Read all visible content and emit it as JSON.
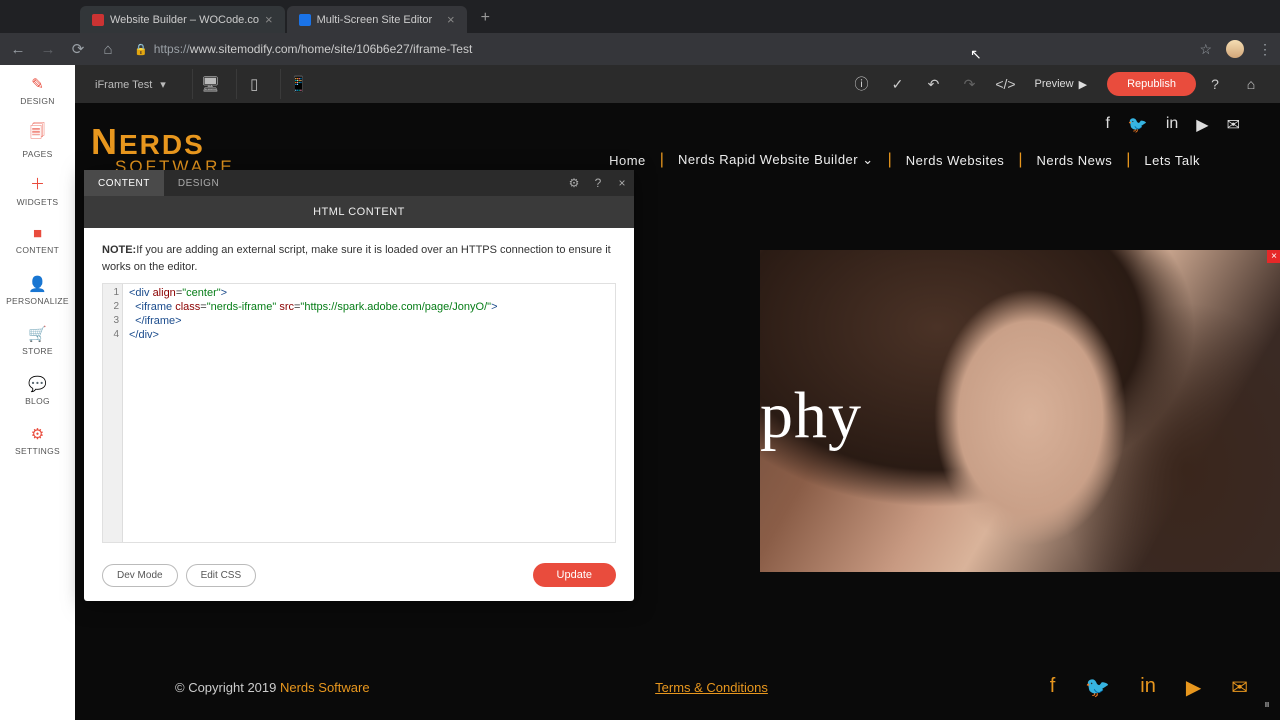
{
  "browser": {
    "tabs": [
      {
        "label": "Website Builder – WOCode.co"
      },
      {
        "label": "Multi-Screen Site Editor"
      }
    ],
    "url_proto": "https://",
    "url_rest": "www.sitemodify.com/home/site/106b6e27/iframe-Test"
  },
  "topbar": {
    "site_name": "iFrame Test",
    "preview": "Preview",
    "republish": "Republish"
  },
  "rail": [
    {
      "icon": "✎",
      "label": "DESIGN"
    },
    {
      "icon": "🗐",
      "label": "PAGES"
    },
    {
      "icon": "＋",
      "label": "WIDGETS"
    },
    {
      "icon": "■",
      "label": "CONTENT"
    },
    {
      "icon": "👤",
      "label": "PERSONALIZE"
    },
    {
      "icon": "🛒",
      "label": "STORE"
    },
    {
      "icon": "💬",
      "label": "BLOG"
    },
    {
      "icon": "⚙",
      "label": "SETTINGS"
    }
  ],
  "site": {
    "logo_main": "NERDS",
    "logo_sub": "SOFTWARE",
    "nav": [
      "Home",
      "Nerds Rapid Website Builder",
      "Nerds Websites",
      "Nerds News",
      "Lets Talk"
    ],
    "hero_fragment": "phy"
  },
  "panel": {
    "tab_content": "CONTENT",
    "tab_design": "DESIGN",
    "title": "HTML CONTENT",
    "note_label": "NOTE:",
    "note_text": "If you are adding an external script, make sure it is loaded over an HTTPS connection to ensure it works on the editor.",
    "code_lines": [
      "1 ▾",
      "2 ▾",
      "3",
      "4"
    ],
    "dev_mode": "Dev Mode",
    "edit_css": "Edit CSS",
    "update": "Update"
  },
  "footer": {
    "copyright_pre": "© Copyright 2019 ",
    "copyright_link": "Nerds Software",
    "terms": "Terms & Conditions"
  }
}
